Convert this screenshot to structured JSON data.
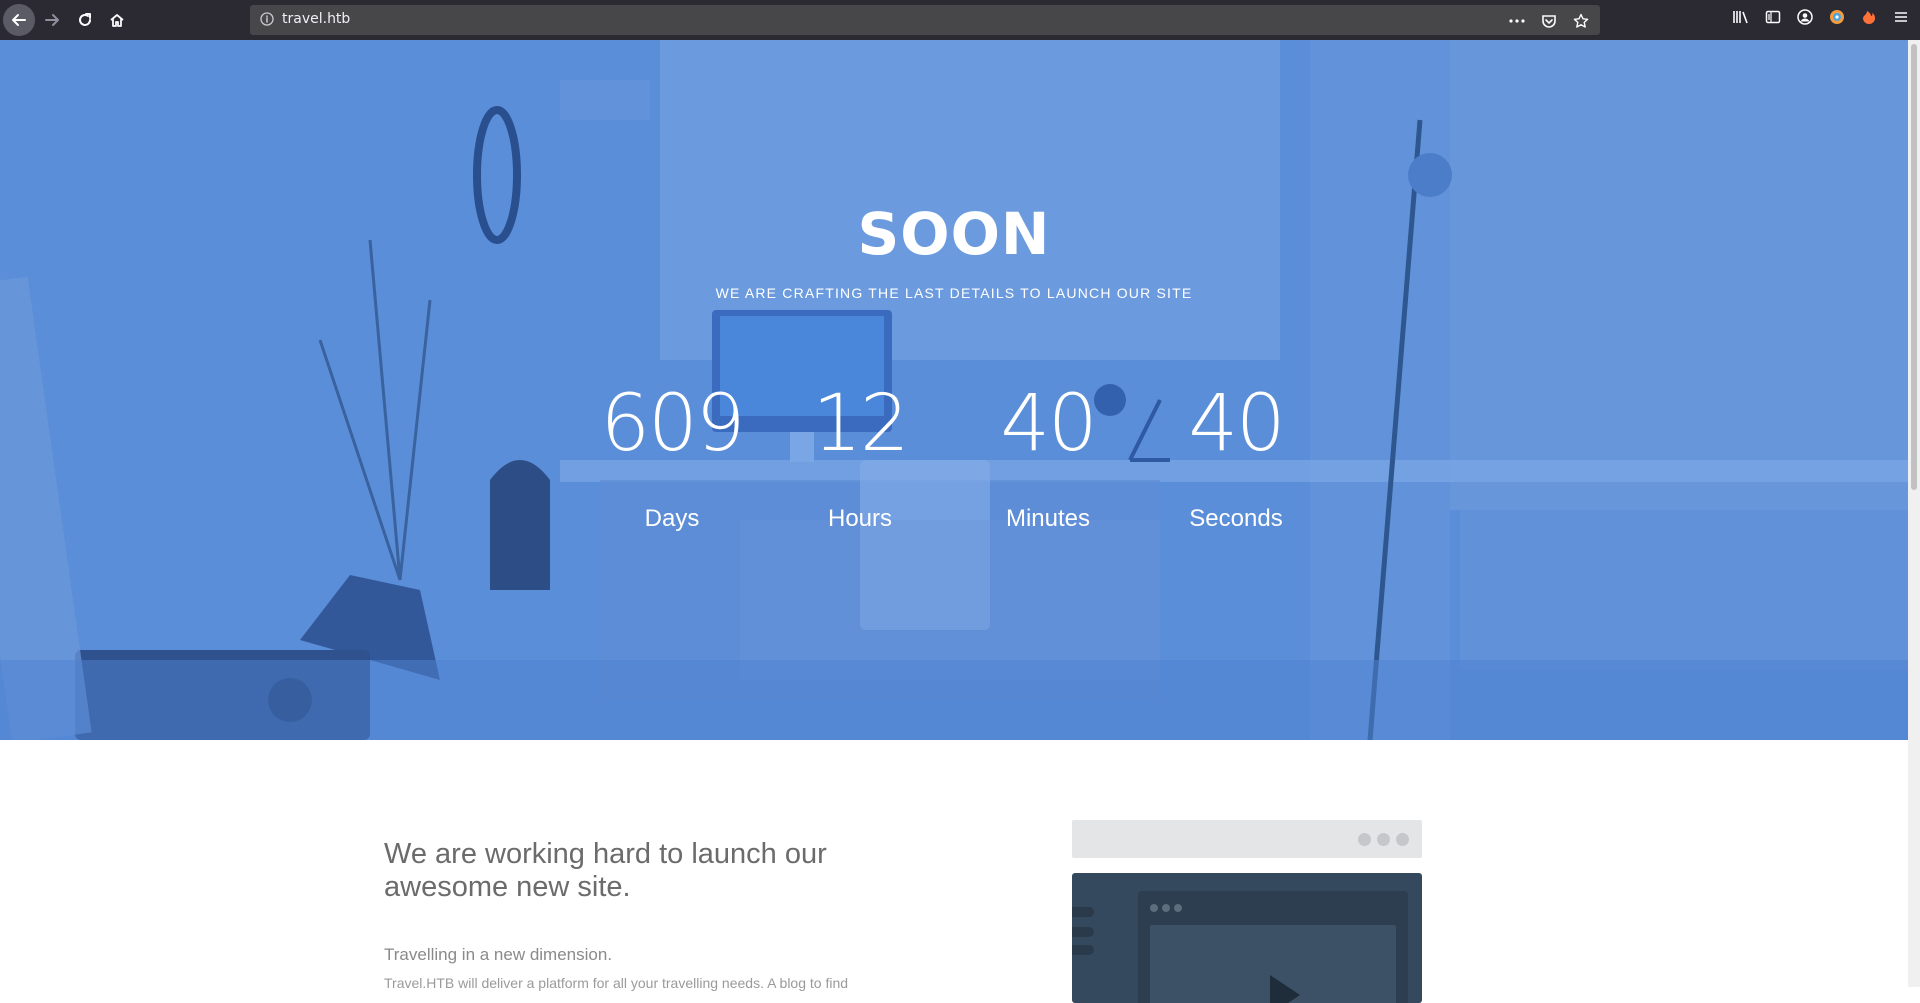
{
  "browser": {
    "url": "travel.htb",
    "icons": [
      "back-arrow-icon",
      "forward-arrow-icon",
      "reload-icon",
      "home-icon",
      "info-icon",
      "more-icon",
      "pocket-icon",
      "star-icon",
      "library-icon",
      "sidebar-icon",
      "account-icon",
      "extension-icon",
      "firefox-icon",
      "menu-icon"
    ]
  },
  "hero": {
    "title": "SOON",
    "subtitle": "WE ARE CRAFTING THE LAST DETAILS TO LAUNCH OUR SITE",
    "countdown": [
      {
        "value": "609",
        "label": "Days"
      },
      {
        "value": "12",
        "label": "Hours"
      },
      {
        "value": "40",
        "label": "Minutes"
      },
      {
        "value": "40",
        "label": "Seconds"
      }
    ],
    "overlay_color": "#5b8ed8"
  },
  "content": {
    "headline": "We are working hard to launch our awesome new site.",
    "lead": "Travelling in a new dimension.",
    "body": "Travel.HTB will deliver a platform for all your travelling needs. A blog to find"
  }
}
